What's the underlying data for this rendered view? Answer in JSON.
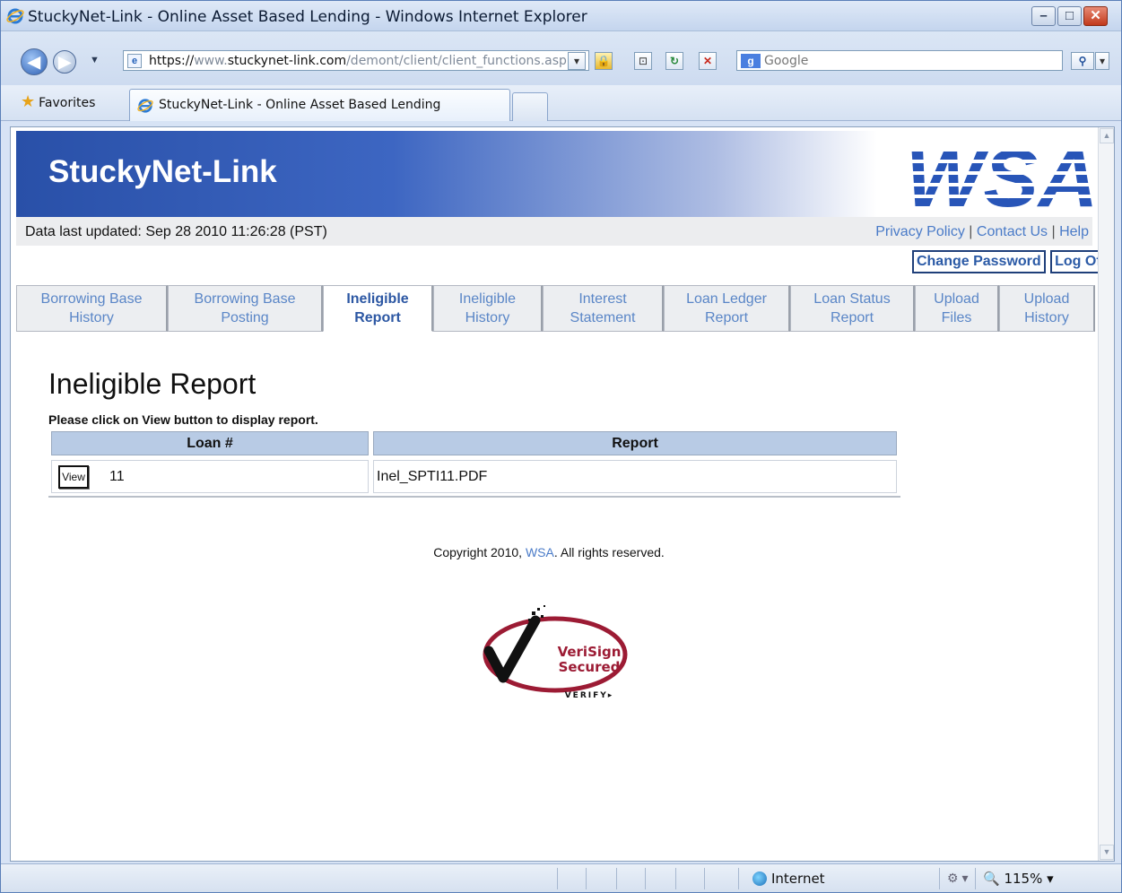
{
  "browser": {
    "window_title": "StuckyNet-Link - Online Asset Based Lending - Windows Internet Explorer",
    "address": {
      "scheme": "https://",
      "host_prefix": "www.",
      "host": "stuckynet-link.com",
      "path": "/demont/client/client_functions.asp"
    },
    "search_placeholder": "Google",
    "favorites_label": "Favorites",
    "tab_title": "StuckyNet-Link - Online Asset Based Lending",
    "status_zone": "Internet",
    "zoom": "115%"
  },
  "site": {
    "brand": "StuckyNet-Link",
    "logo_text": "WSA",
    "data_updated": "Data last updated:  Sep 28 2010 11:26:28 (PST)",
    "links": {
      "privacy": "Privacy Policy",
      "contact": "Contact Us",
      "help": "Help",
      "sep": "|"
    },
    "buttons": {
      "change_password": "Change Password",
      "log_off": "Log Off"
    },
    "tabs": [
      {
        "line1": "Borrowing Base",
        "line2": "History"
      },
      {
        "line1": "Borrowing Base",
        "line2": "Posting"
      },
      {
        "line1": "Ineligible",
        "line2": "Report"
      },
      {
        "line1": "Ineligible",
        "line2": "History"
      },
      {
        "line1": "Interest",
        "line2": "Statement"
      },
      {
        "line1": "Loan Ledger",
        "line2": "Report"
      },
      {
        "line1": "Loan Status",
        "line2": "Report"
      },
      {
        "line1": "Upload",
        "line2": "Files"
      },
      {
        "line1": "Upload",
        "line2": "History"
      }
    ],
    "active_tab_index": 2
  },
  "content": {
    "heading": "Ineligible Report",
    "instruction": "Please click on View button to display report.",
    "table": {
      "headers": [
        "Loan #",
        "Report"
      ],
      "rows": [
        {
          "button": "View",
          "loan": "11",
          "report": "Inel_SPTI11.PDF"
        }
      ]
    },
    "copyright_pre": "Copyright 2010, ",
    "copyright_link": "WSA",
    "copyright_post": ". All rights reserved.",
    "seal": {
      "line1": "VeriSign",
      "line2": "Secured",
      "verify": "VERIFY▸"
    }
  },
  "colors": {
    "banner_dark": "#2950a8",
    "link": "#4a7bc8",
    "tab_active_text": "#2c57a3",
    "table_header": "#b8cbe5",
    "seal_red": "#9c1b34"
  }
}
